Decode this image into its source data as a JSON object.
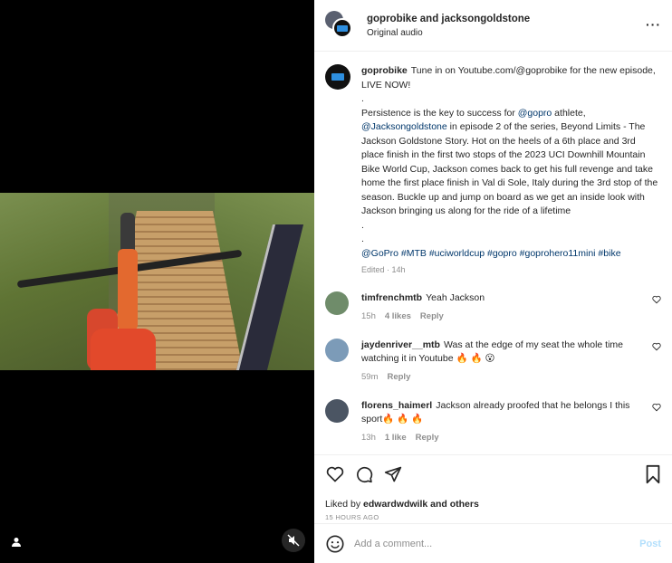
{
  "header": {
    "title": "goprobike and jacksongoldstone",
    "subtitle": "Original audio"
  },
  "caption": {
    "user": "goprobike",
    "line1": "Tune in on Youtube.com/@goprobike for the new episode, LIVE NOW!",
    "dot1": ".",
    "p2_a": "Persistence is the key to success for ",
    "p2_mention1": "@gopro",
    "p2_b": " athlete, ",
    "p2_mention2": "@Jacksongoldstone",
    "p2_c": " in episode 2 of the series, Beyond Limits - The Jackson Goldstone Story. Hot on the heels of a 6th place and 3rd place finish in the first two stops of the 2023 UCI Downhill Mountain Bike World Cup, Jackson comes back to get his full revenge and take home the first place finish in Val di Sole, Italy during the 3rd stop of the season. Buckle up and jump on board as we get an inside look with Jackson bringing us along for the ride of a lifetime",
    "dot2": ".",
    "dot3": ".",
    "hashtags": "@GoPro #MTB #uciworldcup #gopro #goprohero11mini #bike",
    "meta": "Edited · 14h"
  },
  "comments": [
    {
      "user": "timfrenchmtb",
      "text": "Yeah Jackson",
      "time": "15h",
      "likes": "4 likes",
      "reply": "Reply",
      "avatar_color": "#6f8c6a"
    },
    {
      "user": "jaydenriver__mtb",
      "text": "Was at the edge of my seat the whole time watching it in Youtube 🔥 🔥 😮",
      "time": "59m",
      "likes": "",
      "reply": "Reply",
      "avatar_color": "#7c9bb8"
    },
    {
      "user": "florens_haimerl",
      "text": "Jackson already proofed that he belongs I this sport🔥 🔥 🔥",
      "time": "13h",
      "likes": "1 like",
      "reply": "Reply",
      "avatar_color": "#4b5563"
    }
  ],
  "likes": {
    "prefix": "Liked by ",
    "user": "edwardwdwilk",
    "suffix": " and others",
    "timestamp": "15 HOURS AGO"
  },
  "add_comment": {
    "placeholder": "Add a comment...",
    "post_label": "Post"
  },
  "colors": {
    "link": "#00376b",
    "muted": "#8e8e8e",
    "post_disabled": "#b2dffc"
  },
  "icons": {
    "more": "more-options-icon",
    "heart": "heart-icon",
    "comment": "comment-icon",
    "share": "share-icon",
    "bookmark": "bookmark-icon",
    "emoji": "emoji-icon",
    "mute": "muted-speaker-icon",
    "person": "person-tag-icon"
  }
}
